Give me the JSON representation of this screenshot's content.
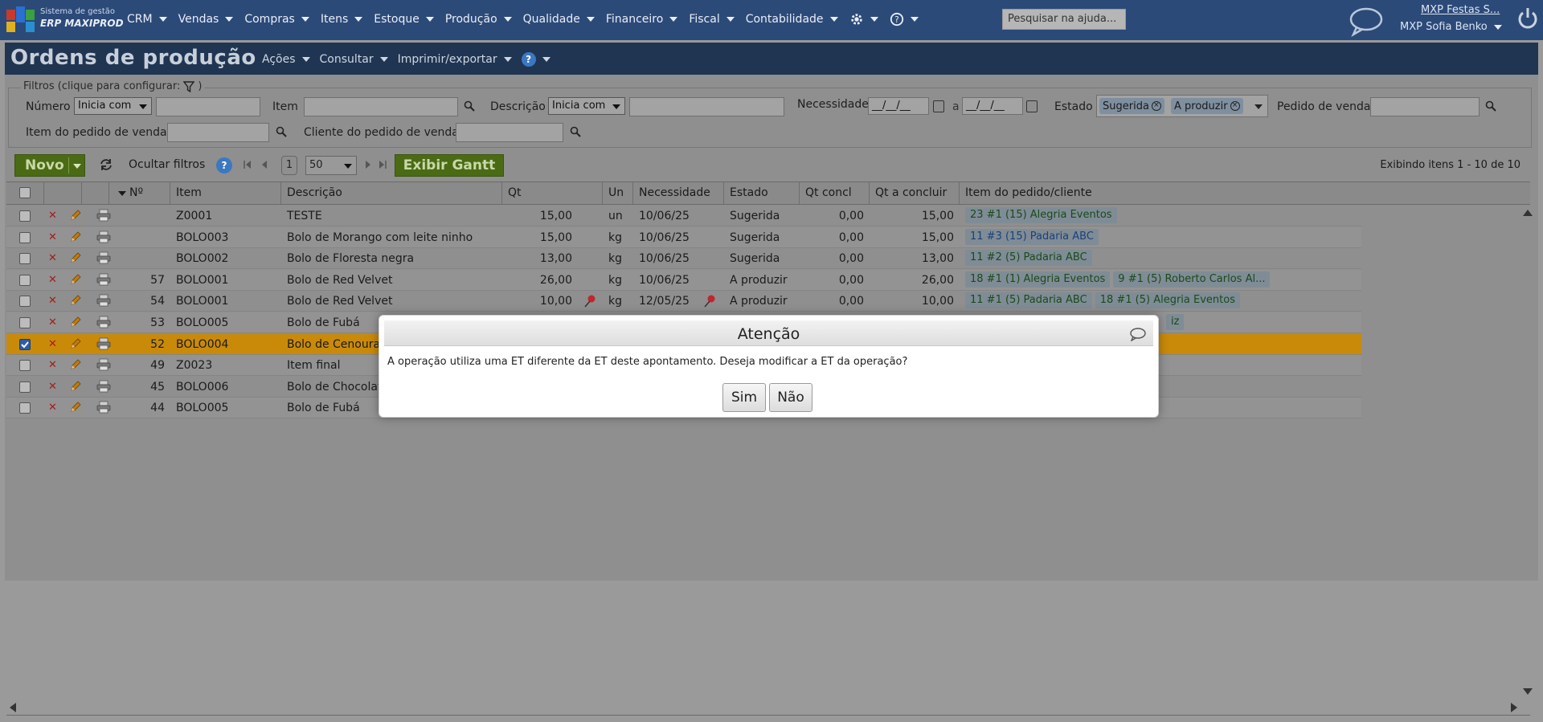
{
  "app": {
    "logo_line1": "Sistema de gestão",
    "logo_line2": "ERP MAXIPROD",
    "menu": [
      "CRM",
      "Vendas",
      "Compras",
      "Itens",
      "Estoque",
      "Produção",
      "Qualidade",
      "Financeiro",
      "Fiscal",
      "Contabilidade"
    ],
    "help_search_placeholder": "Pesquisar na ajuda...",
    "company": "MXP Festas S...",
    "user": "MXP Sofia Benko"
  },
  "page": {
    "title": "Ordens de produção",
    "menu": [
      "Ações",
      "Consultar",
      "Imprimir/exportar"
    ],
    "help_glyph": "?"
  },
  "filters": {
    "legend": "Filtros (clique para configurar:",
    "legend_close": ")",
    "numero_label": "Número",
    "numero_mode": "Inicia com",
    "item_label": "Item",
    "descricao_label": "Descrição",
    "descricao_mode": "Inicia com",
    "necessidade_label": "Necessidade",
    "date_from": "__/__/__",
    "date_sep": "a",
    "date_to": "__/__/__",
    "estado_label": "Estado",
    "estado_chips": [
      "Sugerida",
      "A produzir"
    ],
    "pedido_label": "Pedido de venda",
    "item_pedido_label": "Item do pedido de venda",
    "cliente_pedido_label": "Cliente do pedido de venda"
  },
  "toolbar": {
    "novo_label": "Novo",
    "ocultar_label": "Ocultar filtros",
    "page_number": "1",
    "page_size": "50",
    "gantt_label": "Exibir Gantt",
    "exibindo": "Exibindo itens 1 - 10 de 10"
  },
  "table": {
    "columns": [
      "Nº",
      "Item",
      "Descrição",
      "Qt",
      "Un",
      "Necessidade",
      "Estado",
      "Qt concl",
      "Qt a concluir",
      "Item do pedido/cliente"
    ],
    "rows": [
      {
        "num": "",
        "item": "Z0001",
        "desc": "TESTE",
        "qt": "15,00",
        "un": "un",
        "nec": "10/06/25",
        "estado": "Sugerida",
        "qtc": "0,00",
        "qta": "15,00",
        "tags": [
          "23 #1 (15) Alegria Eventos"
        ]
      },
      {
        "num": "",
        "item": "BOLO003",
        "desc": "Bolo de Morango com leite ninho",
        "qt": "15,00",
        "un": "kg",
        "nec": "10/06/25",
        "estado": "Sugerida",
        "qtc": "0,00",
        "qta": "15,00",
        "tags": [
          "11 #3 (15) Padaria ABC"
        ]
      },
      {
        "num": "",
        "item": "BOLO002",
        "desc": "Bolo de Floresta negra",
        "qt": "13,00",
        "un": "kg",
        "nec": "10/06/25",
        "estado": "Sugerida",
        "qtc": "0,00",
        "qta": "13,00",
        "tags": [
          "11 #2 (5) Padaria ABC"
        ]
      },
      {
        "num": "57",
        "item": "BOLO001",
        "desc": "Bolo de Red Velvet",
        "qt": "26,00",
        "un": "kg",
        "nec": "10/06/25",
        "estado": "A produzir",
        "qtc": "0,00",
        "qta": "26,00",
        "tags": [
          "18 #1 (1) Alegria Eventos",
          "9 #1 (5) Roberto Carlos Al..."
        ]
      },
      {
        "num": "54",
        "item": "BOLO001",
        "desc": "Bolo de Red Velvet",
        "qt": "10,00",
        "un": "kg",
        "nec": "12/05/25",
        "estado": "A produzir",
        "qtc": "0,00",
        "qta": "10,00",
        "tags": [
          "11 #1 (5) Padaria ABC",
          "18 #1 (5) Alegria Eventos"
        ]
      },
      {
        "num": "53",
        "item": "BOLO005",
        "desc": "Bolo de Fubá",
        "qt": "",
        "un": "",
        "nec": "",
        "estado": "",
        "qtc": "",
        "qta": "",
        "tags": [],
        "tail": "iz"
      },
      {
        "num": "52",
        "item": "BOLO004",
        "desc": "Bolo de Cenoura",
        "qt": "",
        "un": "",
        "nec": "",
        "estado": "",
        "qtc": "",
        "qta": "",
        "tags": []
      },
      {
        "num": "49",
        "item": "Z0023",
        "desc": "Item final",
        "qt": "",
        "un": "",
        "nec": "",
        "estado": "",
        "qtc": "",
        "qta": "",
        "tags": []
      },
      {
        "num": "45",
        "item": "BOLO006",
        "desc": "Bolo de Chocolat",
        "qt": "",
        "un": "",
        "nec": "",
        "estado": "",
        "qtc": "",
        "qta": "",
        "tags": []
      },
      {
        "num": "44",
        "item": "BOLO005",
        "desc": "Bolo de Fubá",
        "qt": "",
        "un": "",
        "nec": "",
        "estado": "",
        "qtc": "",
        "qta": "",
        "tags": []
      }
    ]
  },
  "modal": {
    "title": "Atenção",
    "message": "A operação utiliza uma ET diferente da ET deste apontamento. Deseja modificar a ET da operação?",
    "yes_label": "Sim",
    "no_label": "Não"
  }
}
